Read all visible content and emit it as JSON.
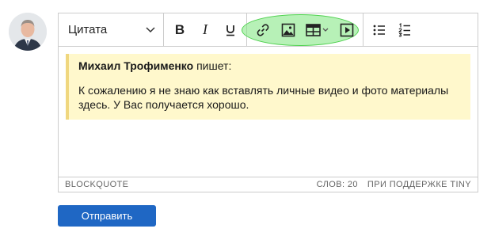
{
  "user": {
    "avatar_icon": "user-avatar"
  },
  "toolbar": {
    "format_select": {
      "value": "Цитата",
      "icon": "chevron-down-icon"
    },
    "buttons": {
      "bold": "B",
      "italic": "I",
      "underline_icon": "underline-icon",
      "link_icon": "link-icon",
      "image_icon": "image-icon",
      "table_icon": "table-icon",
      "media_icon": "media-play-icon",
      "bullet_list_icon": "bullet-list-icon",
      "numbered_list_icon": "numbered-list-icon"
    },
    "highlight_color": "#7ce67c"
  },
  "content": {
    "quote": {
      "author": "Михаил Трофименко",
      "author_suffix": " пишет:",
      "text": "К сожалению я не знаю как вставлять личные видео и фото материалы здесь. У Вас получается хорошо."
    },
    "quote_bg": "#fff8cc",
    "quote_border": "#f0d77f"
  },
  "statusbar": {
    "path": "BLOCKQUOTE",
    "word_count": "СЛОВ: 20",
    "powered_by": "ПРИ ПОДДЕРЖКЕ TINY"
  },
  "submit": {
    "label": "Отправить",
    "color": "#1f67c4"
  }
}
